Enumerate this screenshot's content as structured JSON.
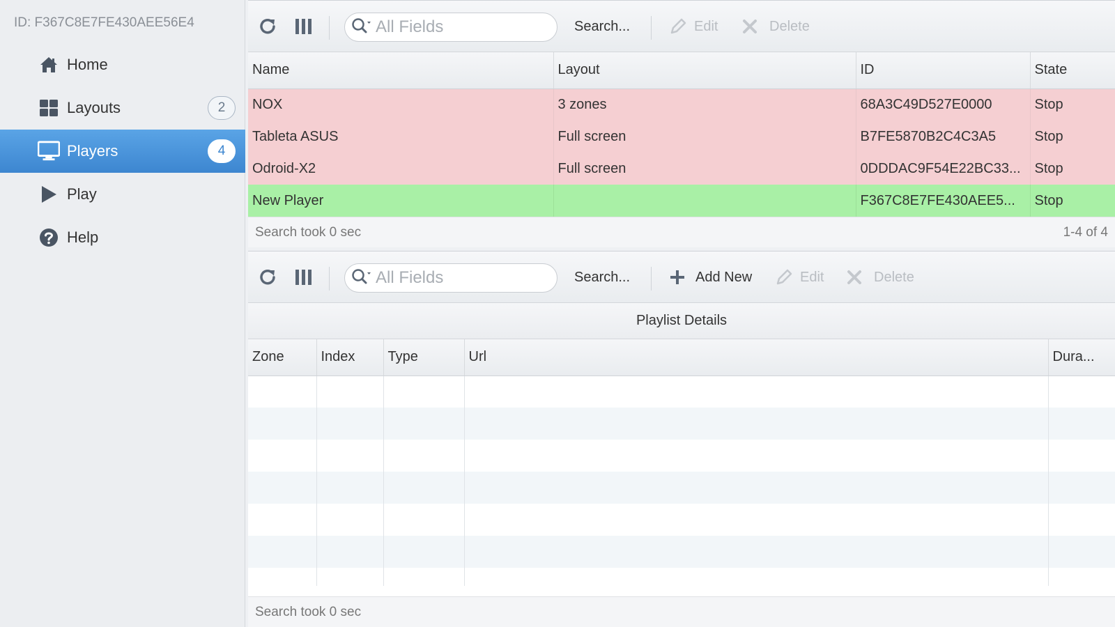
{
  "sidebar": {
    "device_id": "ID: F367C8E7FE430AEE56E4",
    "items": [
      {
        "label": "Home",
        "icon": "home-icon",
        "badge": null
      },
      {
        "label": "Layouts",
        "icon": "grid-icon",
        "badge": "2"
      },
      {
        "label": "Players",
        "icon": "monitor-icon",
        "badge": "4",
        "active": true
      },
      {
        "label": "Play",
        "icon": "play-icon",
        "badge": null
      },
      {
        "label": "Help",
        "icon": "help-icon",
        "badge": null
      }
    ]
  },
  "players_panel": {
    "toolbar": {
      "search_placeholder": "All Fields",
      "search_label": "Search...",
      "edit_label": "Edit",
      "delete_label": "Delete"
    },
    "columns": [
      "Name",
      "Layout",
      "ID",
      "State"
    ],
    "rows": [
      {
        "name": "NOX",
        "layout": "3 zones",
        "id": "68A3C49D527E0000",
        "state": "Stop",
        "status": "stopped"
      },
      {
        "name": "Tableta ASUS",
        "layout": "Full screen",
        "id": "B7FE5870B2C4C3A5",
        "state": "Stop",
        "status": "stopped"
      },
      {
        "name": "Odroid-X2",
        "layout": "Full screen",
        "id": "0DDDAC9F54E22BC33...",
        "state": "Stop",
        "status": "stopped"
      },
      {
        "name": "New Player",
        "layout": "",
        "id": "F367C8E7FE430AEE5...",
        "state": "Stop",
        "status": "green"
      }
    ],
    "footer_status": "Search took 0 sec",
    "footer_count": "1-4 of 4"
  },
  "playlist_panel": {
    "toolbar": {
      "search_placeholder": "All Fields",
      "search_label": "Search...",
      "add_label": "Add New",
      "edit_label": "Edit",
      "delete_label": "Delete"
    },
    "title": "Playlist Details",
    "columns": [
      "Zone",
      "Index",
      "Type",
      "Url",
      "Dura..."
    ],
    "footer_status": "Search took 0 sec"
  },
  "colors": {
    "active_nav": "#3d86d0",
    "row_stopped": "#f5cfd2",
    "row_green": "#a9f0a6"
  }
}
